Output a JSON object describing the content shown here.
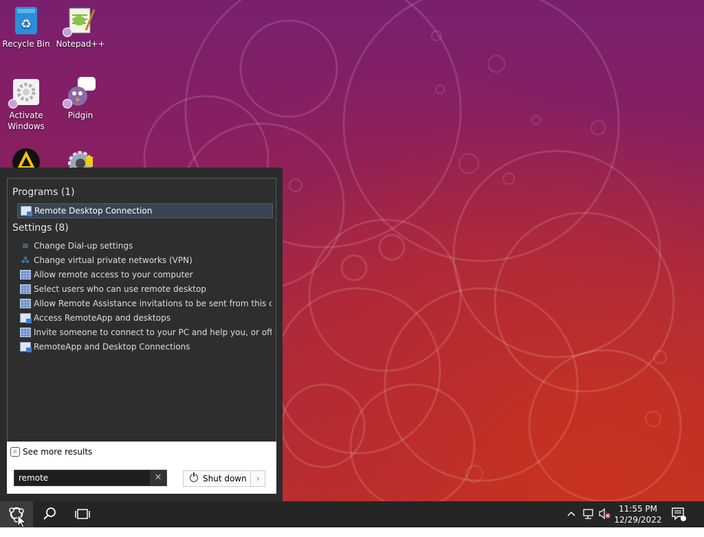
{
  "desktop": {
    "icons": [
      {
        "label": "Recycle Bin",
        "icon": "recycle-bin-icon"
      },
      {
        "label": "Notepad++",
        "icon": "notepad-plus-plus-icon"
      },
      {
        "label": "Activate Windows",
        "icon": "activate-windows-icon"
      },
      {
        "label": "Pidgin",
        "icon": "pidgin-icon"
      }
    ]
  },
  "start_menu": {
    "programs": {
      "header": "Programs (1)",
      "items": [
        {
          "label": "Remote Desktop Connection",
          "icon": "remote-desktop-icon",
          "selected": true
        }
      ]
    },
    "settings": {
      "header": "Settings (8)",
      "items": [
        {
          "label": "Change Dial-up settings",
          "icon": "dialup-icon"
        },
        {
          "label": "Change virtual private networks (VPN)",
          "icon": "vpn-icon"
        },
        {
          "label": "Allow remote access to your computer",
          "icon": "control-panel-icon"
        },
        {
          "label": "Select users who can use remote desktop",
          "icon": "control-panel-icon"
        },
        {
          "label": "Allow Remote Assistance invitations to be sent from this c...",
          "icon": "control-panel-icon"
        },
        {
          "label": "Access RemoteApp and desktops",
          "icon": "remote-desktop-icon"
        },
        {
          "label": "Invite someone to connect to your PC and help you, or offe...",
          "icon": "control-panel-icon"
        },
        {
          "label": "RemoteApp and Desktop Connections",
          "icon": "remote-desktop-icon"
        }
      ]
    },
    "see_more": "See more results",
    "search": {
      "value": "remote",
      "clear_glyph": "✕"
    },
    "shutdown": {
      "label": "Shut down",
      "arrow": "›"
    }
  },
  "taskbar": {
    "start_icon": "start-menu-icon",
    "search_icon": "search-icon",
    "task_view_icon": "task-view-icon",
    "tray": {
      "chevron": "^",
      "network_icon": "network-icon",
      "volume_icon": "volume-muted-icon",
      "notifications_icon": "action-center-icon"
    },
    "clock": {
      "time": "11:55 PM",
      "date": "12/29/2022"
    }
  },
  "colors": {
    "menu_bg": "#2b2b2b",
    "selection": "#3a4452",
    "taskbar": "#252525",
    "wallpaper_top": "#7a1f6e",
    "wallpaper_bottom": "#c0342a"
  }
}
